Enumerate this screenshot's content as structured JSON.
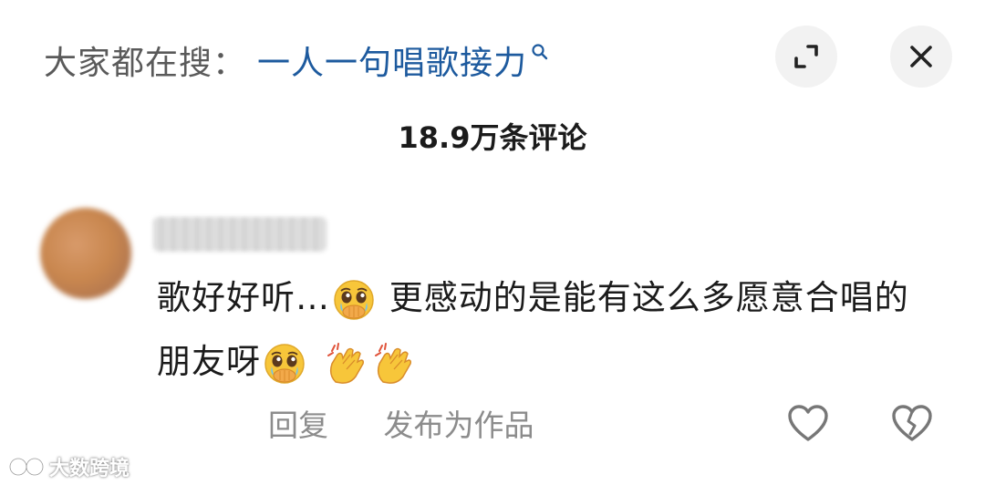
{
  "header": {
    "search_prefix": "大家都在搜：",
    "search_term": "一人一句唱歌接力",
    "search_icon": "search-icon",
    "expand_icon": "expand-icon",
    "close_icon": "close-icon"
  },
  "comment_count": "18.9万条评论",
  "comment": {
    "username_blurred": true,
    "avatar_blurred": true,
    "text_part1": "歌好好听…",
    "emoji1": "pleading-face-hands-over-mouth",
    "text_part2": " 更感动的是能有这么多愿意合唱的朋友呀",
    "emoji2": "pleading-face-hands-over-mouth",
    "emoji3": "clapping-hands",
    "emoji4": "clapping-hands"
  },
  "actions": {
    "reply_label": "回复",
    "publish_label": "发布为作品",
    "like_icon": "heart-outline-icon",
    "dislike_icon": "broken-heart-icon"
  },
  "watermark": {
    "text": "大数跨境"
  },
  "colors": {
    "search_term": "#1d5a9e",
    "prefix": "#5a5a5a",
    "button_bg": "#f2f2f2",
    "action_text": "#8c8c8c"
  }
}
